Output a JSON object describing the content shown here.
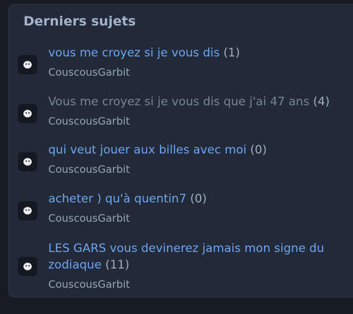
{
  "section": {
    "title": "Derniers sujets"
  },
  "topics": [
    {
      "title": "vous me croyez si je vous dis",
      "count": "(1)",
      "author": "CouscousGarbit",
      "visited": false
    },
    {
      "title": "Vous me croyez si je vous dis que j'ai 47 ans",
      "count": "(4)",
      "author": "CouscousGarbit",
      "visited": true
    },
    {
      "title": "qui veut jouer aux billes avec moi",
      "count": "(0)",
      "author": "CouscousGarbit",
      "visited": false
    },
    {
      "title": "acheter ) qu'à quentin7",
      "count": "(0)",
      "author": "CouscousGarbit",
      "visited": false
    },
    {
      "title": "LES GARS vous devinerez jamais mon signe du zodiaque",
      "count": "(11)",
      "author": "CouscousGarbit",
      "visited": false
    }
  ],
  "colors": {
    "link": "#6ea5ee",
    "visited_link": "#7b8494",
    "author": "#9aa3b2",
    "card_background": "#222938"
  },
  "icons": {
    "avatar": "ghost-avatar-icon"
  }
}
